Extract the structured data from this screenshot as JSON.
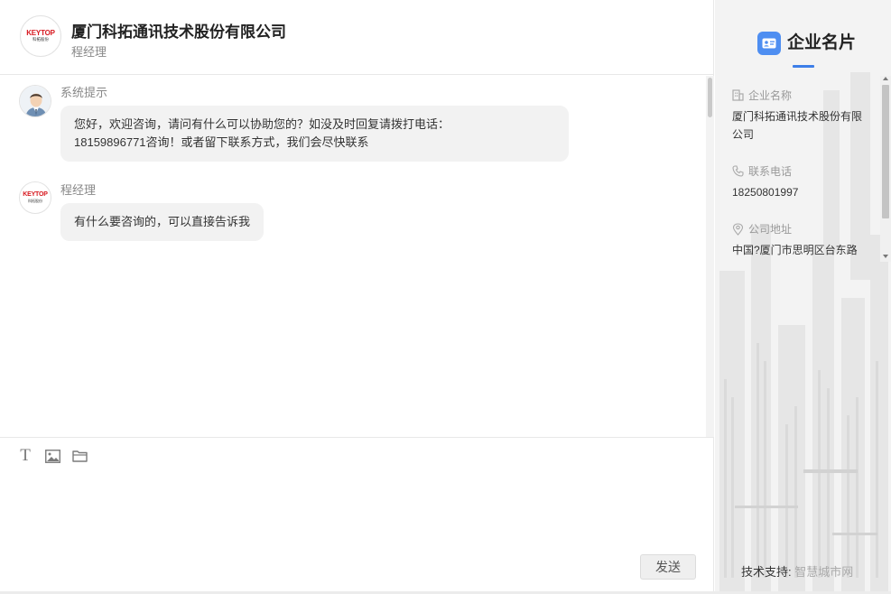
{
  "header": {
    "company_name": "厦门科拓通讯技术股份有限公司",
    "contact_name": "程经理",
    "logo_text": "KEYTOP",
    "logo_subtext": "科拓股份"
  },
  "messages": [
    {
      "sender": "系统提示",
      "line1": "您好，欢迎咨询，请问有什么可以协助您的？如没及时回复请拨打电话：",
      "line2": "18159896771咨询！或者留下联系方式，我们会尽快联系"
    },
    {
      "sender": "程经理",
      "text": "有什么要咨询的，可以直接告诉我"
    }
  ],
  "toolbar": {
    "text_tool": "T"
  },
  "composer": {
    "value": "",
    "send_label": "发送"
  },
  "card": {
    "title": "企业名片",
    "company_label": "企业名称",
    "company_value": "厦门科拓通讯技术股份有限公司",
    "phone_label": "联系电话",
    "phone_value": "18250801997",
    "address_label": "公司地址",
    "address_value": "中国?厦门市思明区台东路"
  },
  "footer": {
    "support_label": "技术支持:",
    "support_link": "智慧城市网"
  },
  "colors": {
    "accent": "#3d7ee8",
    "brand_red": "#d7181f",
    "bubble": "#f2f2f2"
  }
}
